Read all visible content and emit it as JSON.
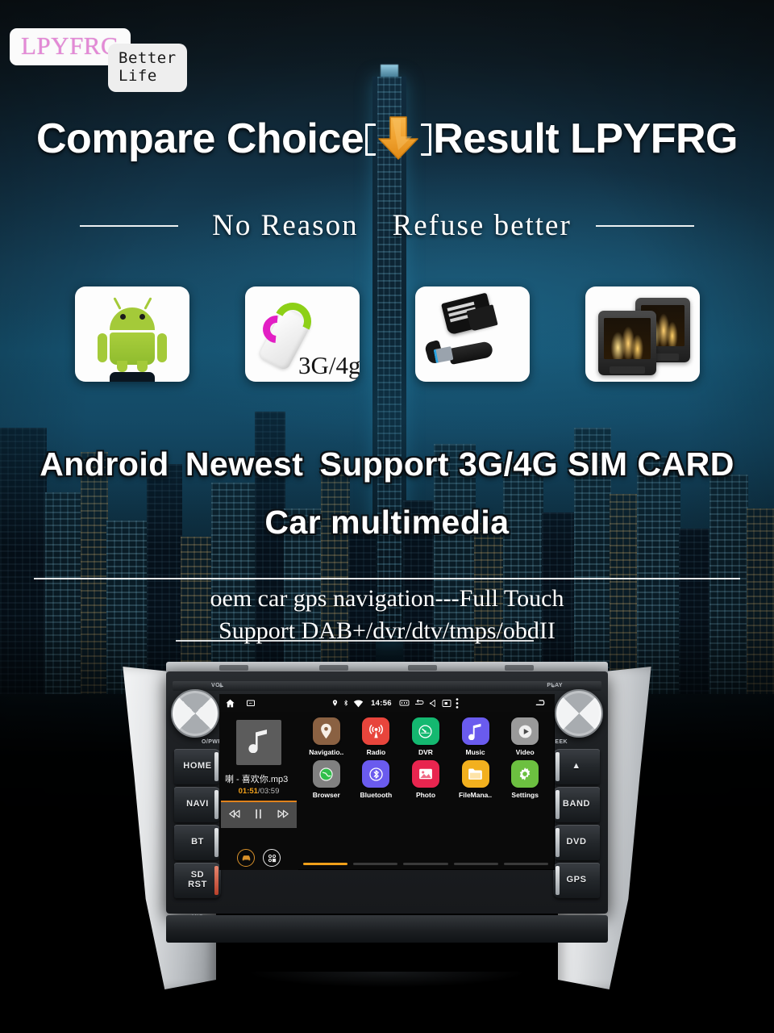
{
  "brand": {
    "logo": "LPYFRG",
    "tagline": "Better Life"
  },
  "headline": {
    "before": "Compare Choice",
    "arrow_icon": "down-arrow-icon",
    "after": "Result LPYFRG"
  },
  "subtitle": {
    "left": "No Reason",
    "right": "Refuse better"
  },
  "feature_cards": [
    {
      "name": "android-icon",
      "label": ""
    },
    {
      "name": "3g-4g-dongle-icon",
      "label": "3G/4g"
    },
    {
      "name": "sd-card-usb-icon",
      "label": ""
    },
    {
      "name": "headrest-monitor-icon",
      "label": ""
    }
  ],
  "promo": {
    "line1_a": "Android",
    "line1_b": "Newest",
    "line1_c": "Support 3G/4G SIM CARD",
    "line2": "Car multimedia"
  },
  "description": {
    "line1": "oem car gps navigation---Full Touch",
    "line2": "Support DAB+/dvr/dtv/tmps/obdII"
  },
  "head_unit": {
    "knob_left_label": "VOL",
    "knob_left_sub": "O/PWR",
    "knob_right_label": "PLAY",
    "knob_right_sub": "SEEK",
    "mic_label": "MIC",
    "buttons_left": [
      {
        "label": "HOME"
      },
      {
        "label": "NAVI"
      },
      {
        "label": "BT"
      },
      {
        "label": "SD\nRST"
      }
    ],
    "buttons_right": [
      {
        "label": "▲"
      },
      {
        "label": "BAND"
      },
      {
        "label": "DVD"
      },
      {
        "label": "GPS"
      }
    ],
    "screen": {
      "status_bar": {
        "home_icon": "home-icon",
        "screenshot_icon": "screenshot-icon",
        "gps_icon": "location-pin-icon",
        "bluetooth_icon": "bluetooth-icon",
        "wifi_icon": "wifi-icon",
        "time": "14:56",
        "sdcard_icon": "sdcard-icon",
        "usb_icon": "usb-icon",
        "mute_icon": "volume-mute-icon",
        "display_icon": "display-icon",
        "overflow_icon": "overflow-menu-icon",
        "back_icon": "back-icon"
      },
      "music_widget": {
        "album_icon": "music-note-icon",
        "track_title": "喇 - 喜欢你.mp3",
        "current_time": "01:51",
        "total_time": "/03:59",
        "prev_icon": "previous-track-icon",
        "pause_icon": "pause-icon",
        "next_icon": "next-track-icon"
      },
      "apps_row1": [
        {
          "label": "Navigatio..",
          "icon": "location-pin-icon",
          "color": "#8a6142"
        },
        {
          "label": "Radio",
          "icon": "radio-waves-icon",
          "color": "#e8453c"
        },
        {
          "label": "DVR",
          "icon": "dashcam-icon",
          "color": "#14b870"
        },
        {
          "label": "Music",
          "icon": "music-note-icon",
          "color": "#6a5bee"
        },
        {
          "label": "Video",
          "icon": "play-circle-icon",
          "color": "#9a9a9a"
        }
      ],
      "apps_row2": [
        {
          "label": "Browser",
          "icon": "globe-icon",
          "color": "#808080"
        },
        {
          "label": "Bluetooth",
          "icon": "bluetooth-icon",
          "color": "#6a5bee"
        },
        {
          "label": "Photo",
          "icon": "photo-icon",
          "color": "#e8254f"
        },
        {
          "label": "FileMana..",
          "icon": "folder-icon",
          "color": "#f2b01e"
        },
        {
          "label": "Settings",
          "icon": "gear-icon",
          "color": "#6cc040"
        }
      ],
      "dock": [
        {
          "icon": "car-mode-icon",
          "color": "#d9912a"
        },
        {
          "icon": "app-drawer-icon",
          "color": "#e8e8e8"
        }
      ],
      "page_indicator": {
        "pages": 5,
        "active": 0
      }
    }
  },
  "colors": {
    "accent_orange": "#f0a01a",
    "logo_pink": "#e389d6",
    "sky_top": "#0c1419",
    "sky_mid": "#15506d"
  }
}
